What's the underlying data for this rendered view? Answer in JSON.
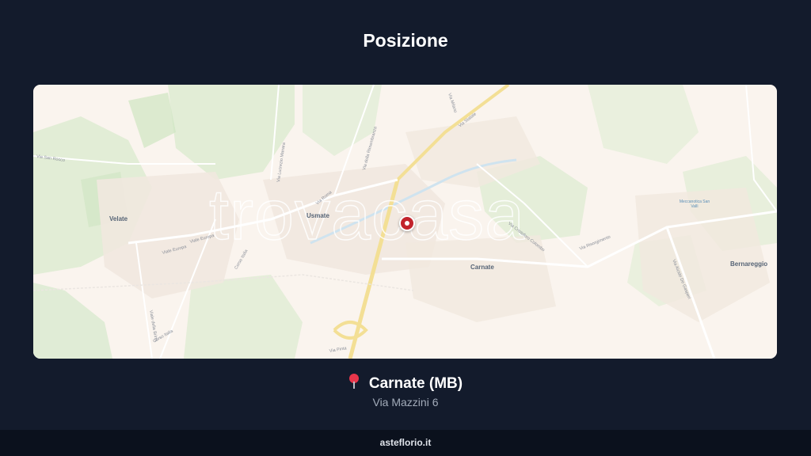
{
  "section": {
    "title": "Posizione"
  },
  "map": {
    "watermark": "trovacasa",
    "places": {
      "velate": "Velate",
      "usmate": "Usmate",
      "carnate": "Carnate",
      "bernareggio": "Bernareggio"
    },
    "roads": {
      "via_san_rocco": "Via San Rocco",
      "via_lucrezio_manara": "Via Lucrezio Manara",
      "via_della_rimembranza": "Via della Rimembranza",
      "via_statale": "Via Statale",
      "via_milano": "Via Milano",
      "via_roma": "Via Roma",
      "viale_europa_1": "Viale Europa",
      "viale_europa_2": "Viale Europa",
      "corso_italia_1": "Corso Italia",
      "corso_italia_2": "Corso Italia",
      "via_della_brina": "Viale della Brina",
      "via_risorgimento": "Via Risorgimento",
      "via_alcide": "Via Alcide De Gasperi",
      "via_cristoforo": "Via Cristoforo Colombo",
      "via_pinta": "Via Pinta"
    },
    "poi": "Meccanotica San Vallì",
    "marker_icon": "location-marker-icon"
  },
  "location": {
    "pin_icon": "pin-icon",
    "city": "Carnate (MB)",
    "address": "Via Mazzini 6"
  },
  "footer": {
    "site": "asteflorio.it"
  },
  "colors": {
    "background": "#131b2c",
    "map_base": "#faf4ee",
    "marker": "#c2242c",
    "pin": "#e8364b",
    "footer": "#0b111d"
  }
}
